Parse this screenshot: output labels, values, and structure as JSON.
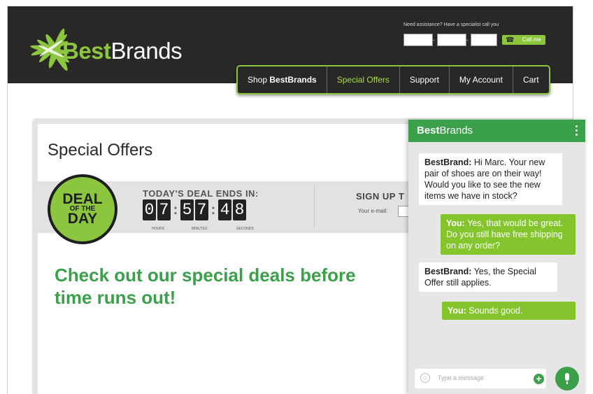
{
  "header": {
    "logo_bold": "Best",
    "logo_rest": "Brands",
    "assist_text": "Need assistance? Have a specialist call you",
    "call_button": "Call me"
  },
  "nav": {
    "items": [
      {
        "prefix": "Shop ",
        "bold": "BestBrands"
      },
      {
        "label": "Special Offers"
      },
      {
        "label": "Support"
      },
      {
        "label": "My Account"
      },
      {
        "label": "Cart"
      }
    ]
  },
  "main": {
    "title": "Special Offers",
    "deal": {
      "line1": "DEAL",
      "line2": "OF THE",
      "line3": "DAY"
    },
    "countdown": {
      "heading": "TODAY'S DEAL ENDS IN:",
      "hours": [
        "0",
        "7"
      ],
      "minutes": [
        "5",
        "7"
      ],
      "seconds": [
        "4",
        "8"
      ],
      "label_hours": "HOURS",
      "label_minutes": "MINUTES",
      "label_seconds": "SECONDS"
    },
    "signup": {
      "heading": "SIGN UP T",
      "email_label": "Your e-mail:"
    },
    "promo": "Check out our special deals before time runs out!"
  },
  "chat": {
    "title_bold": "Best",
    "title_rest": "Brands",
    "messages": [
      {
        "from": "bot",
        "sender": "BestBrand:",
        "text": " Hi Marc. Your new pair of shoes are on their way! Would you like to see the new items we have in stock?"
      },
      {
        "from": "user",
        "sender": "You:",
        "text": " Yes, that would be great. Do you still have free shipping on any order?"
      },
      {
        "from": "bot",
        "sender": "BestBrand:",
        "text": " Yes, the Special Offer still applies."
      },
      {
        "from": "user",
        "sender": "You:",
        "text": " Sounds good."
      }
    ],
    "input_placeholder": "Type a message"
  },
  "colors": {
    "brand_green": "#3aa04a",
    "lime": "#8cc63f",
    "header_dark": "#2a2727"
  }
}
